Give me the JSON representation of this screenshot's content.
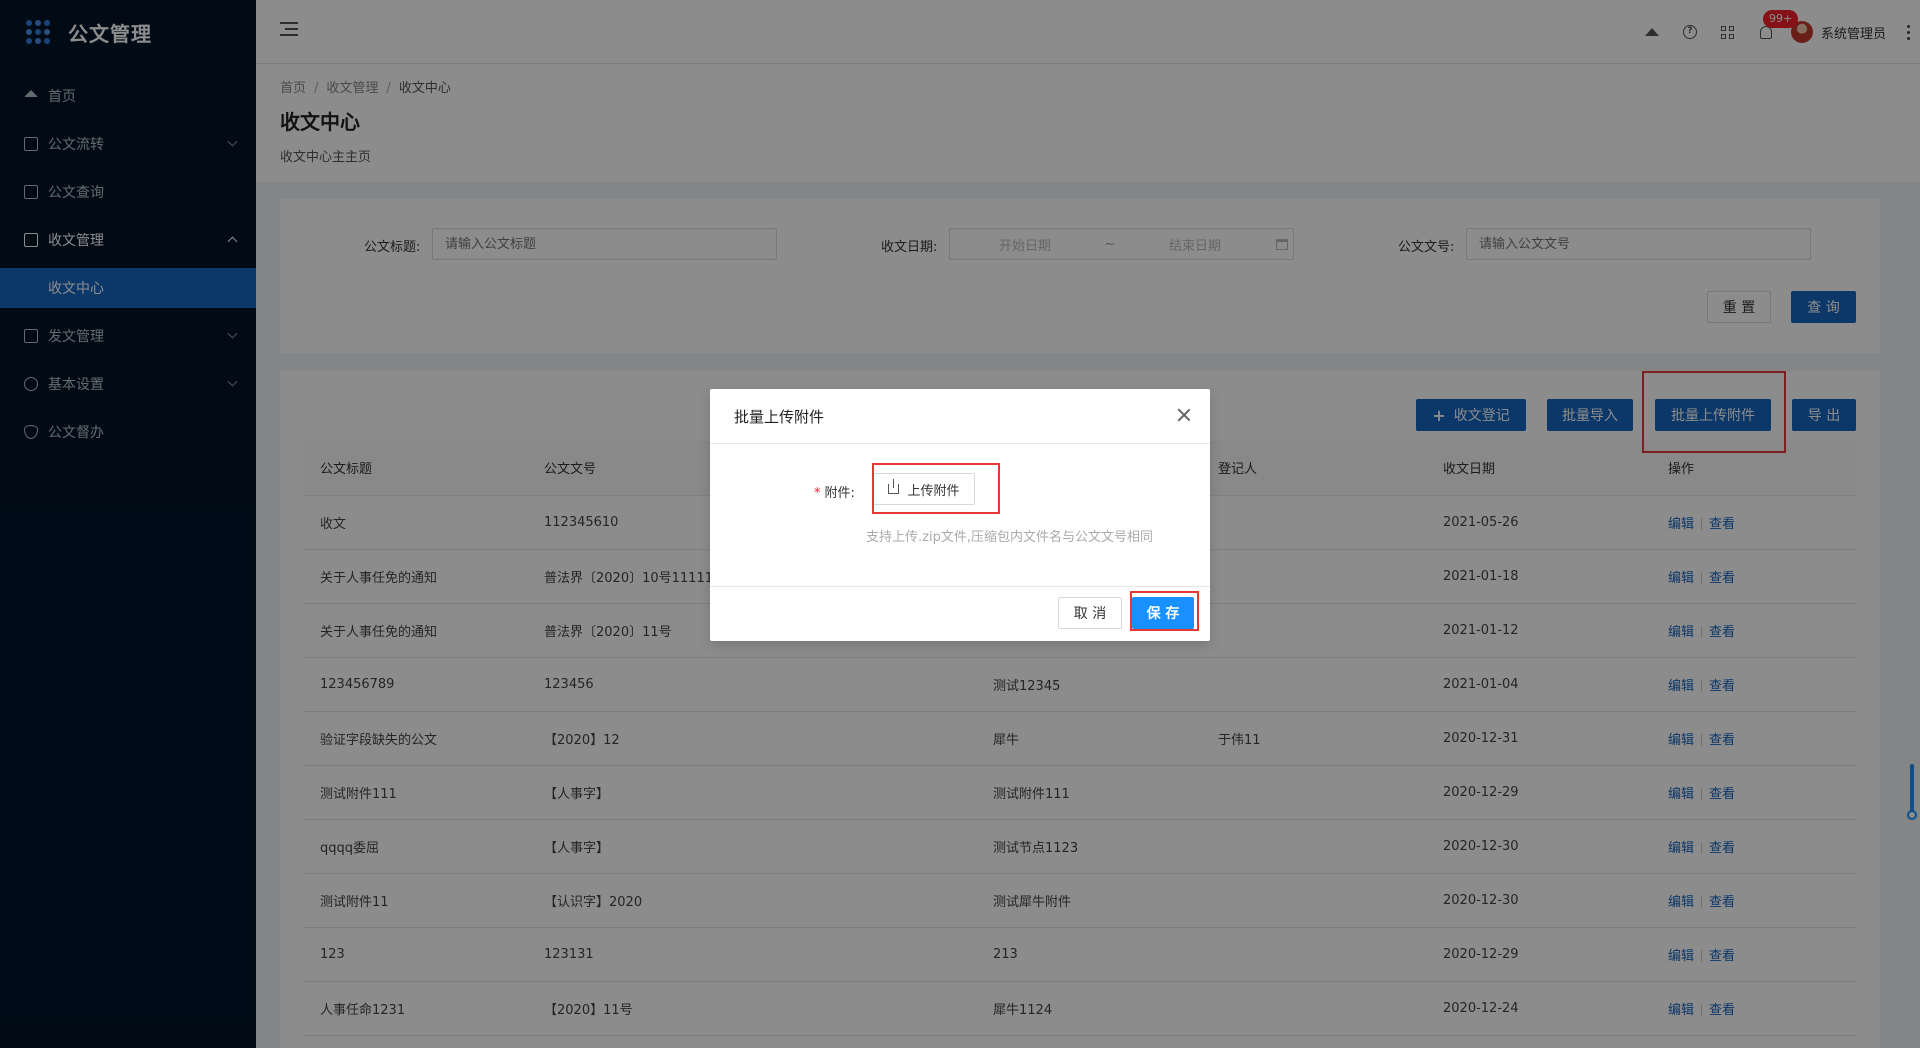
{
  "app": {
    "title": "公文管理"
  },
  "sidebar": {
    "items": [
      {
        "label": "首页"
      },
      {
        "label": "公文流转"
      },
      {
        "label": "公文查询"
      },
      {
        "label": "收文管理"
      },
      {
        "label": "发文管理"
      },
      {
        "label": "基本设置"
      },
      {
        "label": "公文督办"
      }
    ],
    "submenu": {
      "label": "收文中心"
    }
  },
  "header": {
    "notification_count": "99+",
    "user_name": "系统管理员"
  },
  "breadcrumb": {
    "items": [
      "首页",
      "收文管理",
      "收文中心"
    ],
    "separator": "/"
  },
  "page": {
    "title": "收文中心",
    "description": "收文中心主主页"
  },
  "search": {
    "title_label": "公文标题:",
    "title_placeholder": "请输入公文标题",
    "date_label": "收文日期:",
    "date_start_placeholder": "开始日期",
    "date_sep": "~",
    "date_end_placeholder": "结束日期",
    "number_label": "公文文号:",
    "number_placeholder": "请输入公文文号",
    "reset_label": "重 置",
    "query_label": "查 询"
  },
  "toolbar": {
    "register_label": "收文登记",
    "batch_import_label": "批量导入",
    "batch_upload_label": "批量上传附件",
    "export_label": "导 出"
  },
  "table": {
    "columns": [
      "公文标题",
      "公文文号",
      "",
      "登记人",
      "收文日期",
      "操作"
    ],
    "edit_label": "编辑",
    "view_label": "查看",
    "rows": [
      {
        "title": "收文",
        "number": "112345610",
        "col3": "",
        "registrant": "",
        "date": "2021-05-26"
      },
      {
        "title": "关于人事任免的通知",
        "number": "普法界〔2020〕10号11111",
        "col3": "",
        "registrant": "",
        "date": "2021-01-18"
      },
      {
        "title": "关于人事任免的通知",
        "number": "普法界〔2020〕11号",
        "col3": "",
        "registrant": "",
        "date": "2021-01-12"
      },
      {
        "title": "123456789",
        "number": "123456",
        "col3": "测试12345",
        "registrant": "",
        "date": "2021-01-04"
      },
      {
        "title": "验证字段缺失的公文",
        "number": "【2020】12",
        "col3": "犀牛",
        "registrant": "于伟11",
        "date": "2020-12-31"
      },
      {
        "title": "测试附件111",
        "number": "【人事字】",
        "col3": "测试附件111",
        "registrant": "",
        "date": "2020-12-29"
      },
      {
        "title": "qqqq委屈",
        "number": "【人事字】",
        "col3": "测试节点1123",
        "registrant": "",
        "date": "2020-12-30"
      },
      {
        "title": "测试附件11",
        "number": "【认识字】2020",
        "col3": "测试犀牛附件",
        "registrant": "",
        "date": "2020-12-30"
      },
      {
        "title": "123",
        "number": "123131",
        "col3": "213",
        "registrant": "",
        "date": "2020-12-29"
      },
      {
        "title": "人事任命1231",
        "number": "【2020】11号",
        "col3": "犀牛1124",
        "registrant": "",
        "date": "2020-12-24"
      }
    ]
  },
  "modal": {
    "title": "批量上传附件",
    "required_mark": "*",
    "attach_label": "附件:",
    "upload_label": "上传附件",
    "hint": "支持上传.zip文件,压缩包内文件名与公文文号相同",
    "cancel_label": "取 消",
    "save_label": "保 存"
  },
  "colors": {
    "sidebar_bg": "#001529",
    "primary": "#1565c0",
    "highlight": "#e53935"
  }
}
